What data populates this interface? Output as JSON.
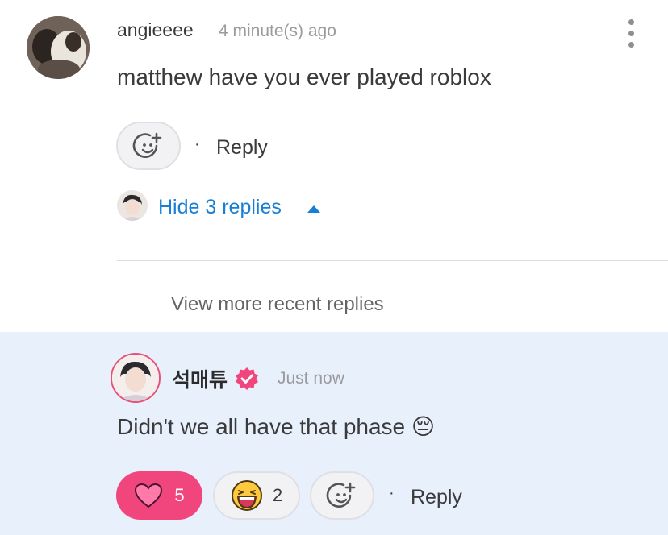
{
  "parent_comment": {
    "username": "angieeee",
    "timestamp": "4 minute(s) ago",
    "text": "matthew have you ever played roblox",
    "reply_label": "Reply",
    "hide_replies_label": "Hide 3 replies",
    "more_icon": "kebab-menu-icon",
    "react_icon": "add-reaction-icon"
  },
  "thread": {
    "view_more_label": "View more recent replies"
  },
  "reply": {
    "username": "석매튜",
    "verified_icon": "verified-badge-icon",
    "timestamp": "Just now",
    "text": "Didn't we all have that phase 😔",
    "reactions": [
      {
        "icon": "heart-icon",
        "count": "5",
        "active": true
      },
      {
        "icon": "laughing-face-icon",
        "count": "2",
        "active": false
      }
    ],
    "react_icon": "add-reaction-icon",
    "reply_label": "Reply"
  },
  "colors": {
    "accent_blue": "#1a7fd4",
    "heart_pink": "#f0467d",
    "highlight_bg": "#e7f0fb",
    "verified_pink": "#f0467d"
  }
}
